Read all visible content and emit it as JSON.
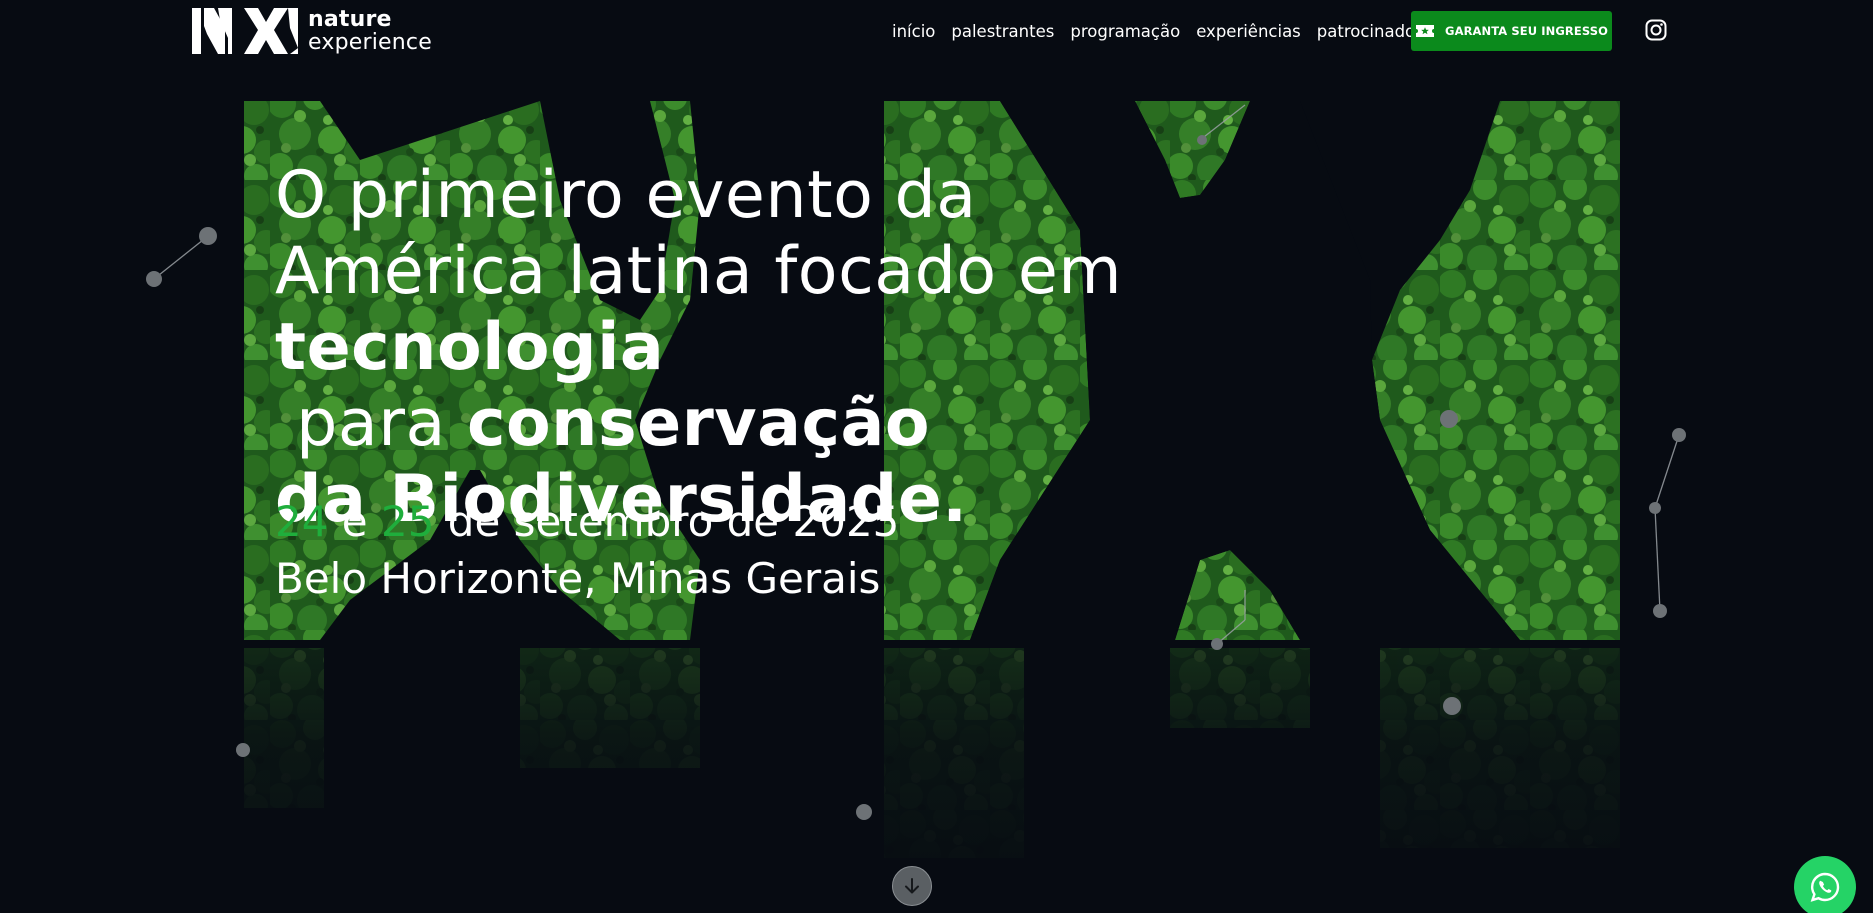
{
  "brand": {
    "name_line1": "nature",
    "name_line2": "experience"
  },
  "nav": {
    "items": [
      {
        "label": "início"
      },
      {
        "label": "palestrantes"
      },
      {
        "label": "programação"
      },
      {
        "label": "experiências"
      },
      {
        "label": "patrocinadores"
      }
    ],
    "cta_label": "GARANTA SEU INGRESSO",
    "cta_icon": "ticket-icon",
    "social_icon": "instagram-icon"
  },
  "hero": {
    "title_line1": "O primeiro evento da",
    "title_line2": "América latina focado em",
    "title_bold1": "tecnologia",
    "title_mid": " para ",
    "title_bold2": "conservação",
    "title_bold3": "da Biodiversidade.",
    "date_day1": "24",
    "date_sep": " e ",
    "date_day2": "25",
    "date_rest": " de setembro de 2025",
    "location": "Belo Horizonte, Minas Gerais"
  },
  "colors": {
    "background": "#070b12",
    "accent_green": "#1fae3c",
    "cta_green": "#0b8a1c",
    "whatsapp_green": "#25d366"
  },
  "floating": {
    "scroll_icon": "arrow-down-icon",
    "chat_icon": "whatsapp-icon"
  }
}
